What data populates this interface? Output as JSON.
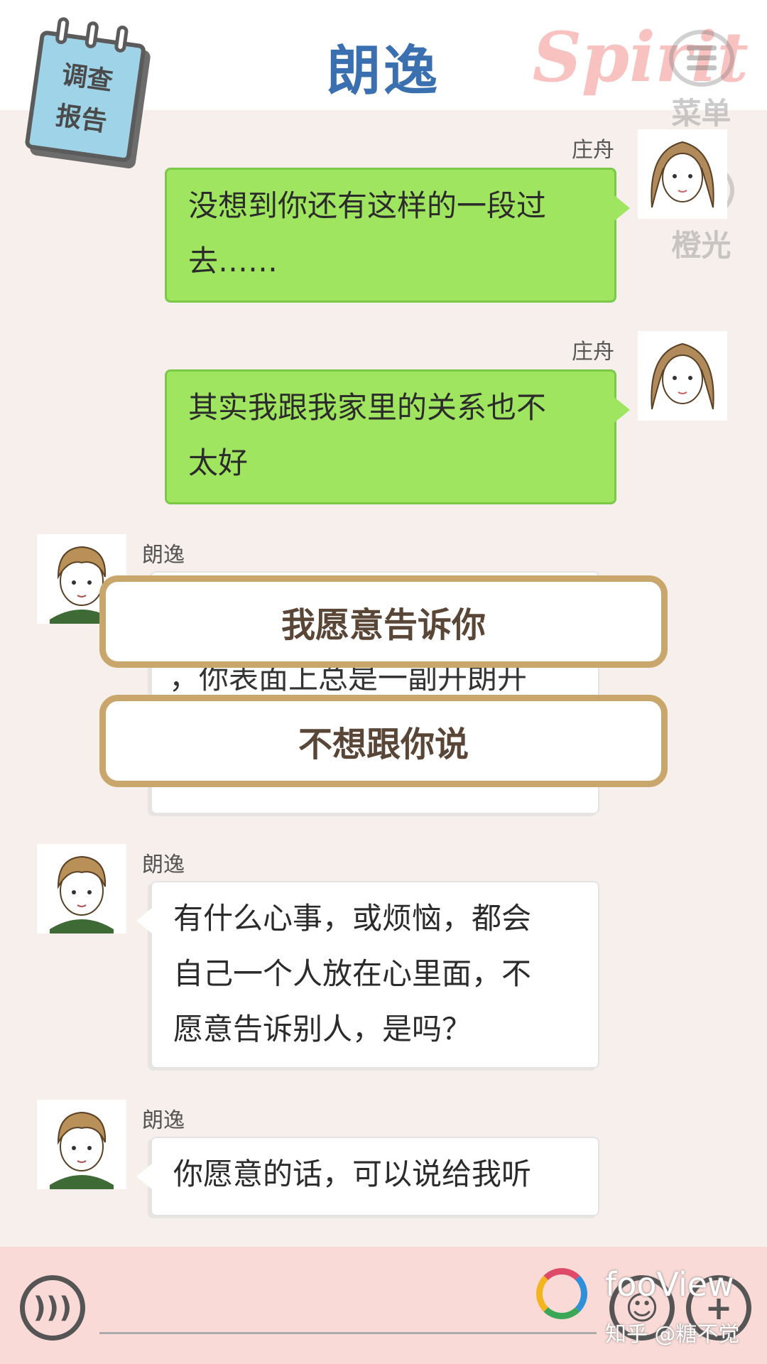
{
  "header": {
    "title": "朗逸",
    "brand_watermark": "Spirit",
    "report_label_line1": "调查",
    "report_label_line2": "报告",
    "menu_label": "菜单",
    "light_label": "橙光"
  },
  "messages": [
    {
      "sender": "庄舟",
      "side": "right",
      "text_line1": "没想到你还有这样的一段过",
      "text_line2": "去……"
    },
    {
      "sender": "庄舟",
      "side": "right",
      "text_line1": "其实我跟我家里的关系也不",
      "text_line2": "太好"
    },
    {
      "sender": "朗逸",
      "side": "left",
      "partial_text": "，你表面上总是一副开朗开"
    },
    {
      "sender": "朗逸",
      "side": "left",
      "text_line1": "有什么心事，或烦恼，都会",
      "text_line2": "自己一个人放在心里面，不",
      "text_line3": "愿意告诉别人，是吗？"
    },
    {
      "sender": "朗逸",
      "side": "left",
      "text_line1": "你愿意的话，可以说给我听"
    }
  ],
  "choices": [
    "我愿意告诉你",
    "不想跟你说"
  ],
  "bottom": {
    "foo_label": "fooView",
    "zhihu_label": "知乎 @糖不觉"
  },
  "colors": {
    "title_blue": "#3a6fb0",
    "bubble_green": "#9fe55f",
    "choice_border": "#c9a66b",
    "bottom_bar": "#fadad6"
  }
}
